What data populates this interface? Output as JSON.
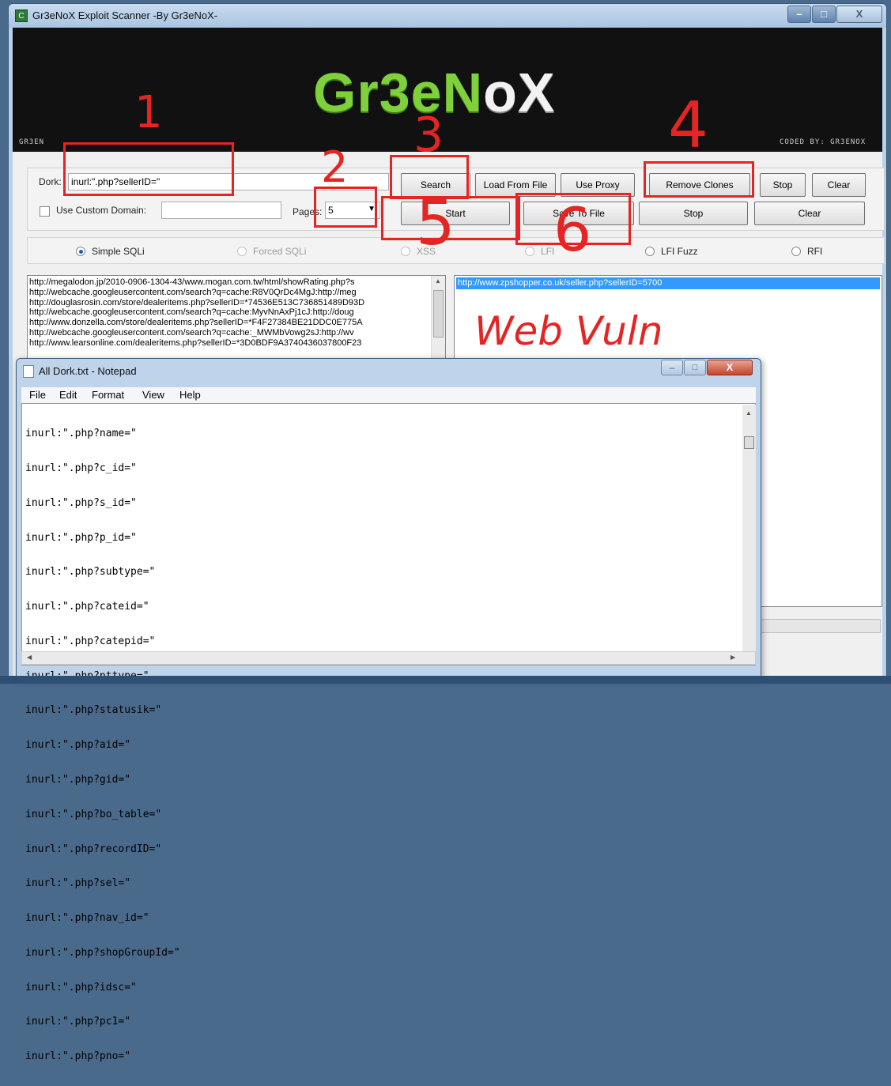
{
  "window": {
    "title": "Gr3eNoX Exploit Scanner -By Gr3eNoX-",
    "icon_letter": "C"
  },
  "banner": {
    "logo_part1": "Gr3e",
    "logo_part2": "N",
    "logo_part3": "o",
    "logo_part4": "X",
    "left_text": "GR3EN",
    "right_text": "CODED BY: GR3ENOX"
  },
  "form": {
    "dork_label": "Dork:",
    "dork_value": "inurl:\".php?sellerID=\"",
    "custom_domain_label": "Use Custom Domain:",
    "custom_domain_value": "",
    "pages_label": "Pages:",
    "pages_value": "5"
  },
  "buttons": {
    "search": "Search",
    "load_from_file": "Load From File",
    "use_proxy": "Use Proxy",
    "remove_clones": "Remove Clones",
    "stop_top": "Stop",
    "clear_top": "Clear",
    "start": "Start",
    "save_to_file": "Save To File",
    "stop_bottom": "Stop",
    "clear_bottom": "Clear"
  },
  "modes": [
    {
      "label": "Simple SQLi",
      "selected": true,
      "enabled": true
    },
    {
      "label": "Forced SQLi",
      "selected": false,
      "enabled": false
    },
    {
      "label": "XSS",
      "selected": false,
      "enabled": false
    },
    {
      "label": "LFI",
      "selected": false,
      "enabled": false
    },
    {
      "label": "LFI Fuzz",
      "selected": false,
      "enabled": true
    },
    {
      "label": "RFI",
      "selected": false,
      "enabled": true
    }
  ],
  "results_left": [
    "http://megalodon.jp/2010-0906-1304-43/www.mogan.com.tw/html/showRating.php?s",
    "http://webcache.googleusercontent.com/search?q=cache:R8V0QrDc4MgJ:http://meg",
    "http://douglasrosin.com/store/dealeritems.php?sellerID=*74536E513C736851489D93D",
    "http://webcache.googleusercontent.com/search?q=cache:MyvNnAxPj1cJ:http://doug",
    "http://www.donzella.com/store/dealeritems.php?sellerID=*F4F27384BE21DDC0E775A",
    "http://webcache.googleusercontent.com/search?q=cache:_MWMbVowg2sJ:http://wv",
    "http://www.learsonline.com/dealeritems.php?sellerID=*3D0BDF9A3740436037800F23"
  ],
  "results_right": [
    "http://www.zpshopper.co.uk/seller.php?sellerID=5700"
  ],
  "annotations": {
    "n1": "1",
    "n2": "2",
    "n3": "3",
    "n4": "4",
    "n5": "5",
    "n6": "6",
    "web_vuln": "Web Vuln"
  },
  "notepad": {
    "title": "All Dork.txt - Notepad",
    "menu": [
      "File",
      "Edit",
      "Format",
      "View",
      "Help"
    ],
    "lines": [
      "inurl:\".php?name=\"",
      "inurl:\".php?c_id=\"",
      "inurl:\".php?s_id=\"",
      "inurl:\".php?p_id=\"",
      "inurl:\".php?subtype=\"",
      "inurl:\".php?cateid=\"",
      "inurl:\".php?catepid=\"",
      "inurl:\".php?pttype=\"",
      "inurl:\".php?statusik=\"",
      "inurl:\".php?aid=\"",
      "inurl:\".php?gid=\"",
      "inurl:\".php?bo_table=\"",
      "inurl:\".php?recordID=\"",
      "inurl:\".php?sel=\"",
      "inurl:\".php?nav_id=\"",
      "inurl:\".php?shopGroupId=\"",
      "inurl:\".php?idsc=\"",
      "inurl:\".php?pc1=\"",
      "inurl:\".php?pno=\""
    ]
  }
}
